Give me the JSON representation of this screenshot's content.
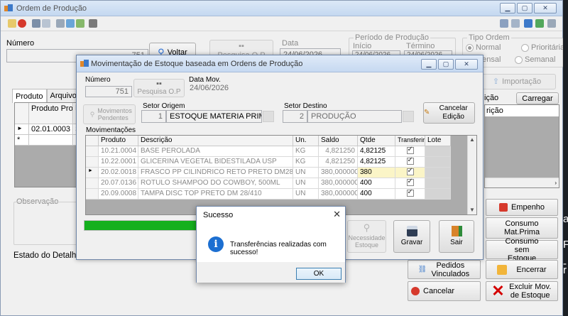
{
  "main": {
    "title": "Ordem de Produção",
    "numero_label": "Número",
    "numero_value": "751",
    "voltar_label": "Voltar",
    "pesquisa_op_label": "Pesquisa O.P",
    "data_label": "Data",
    "data_value": "24/06/2026",
    "periodo_label": "Período de Produção",
    "inicio_label": "Início",
    "termino_label": "Término",
    "inicio_value": "24/06/2026",
    "termino_value": "24/06/2026",
    "tipo_ordem_label": "Tipo Ordem",
    "radio_normal": "Normal",
    "radio_prioritaria": "Prioritária",
    "radio_mensal": "Mensal",
    "radio_semanal": "Semanal",
    "importacao_label": "Importação",
    "tabs": [
      "Produto",
      "Arquivos"
    ],
    "grid_headers": [
      "Produto Produção",
      "D"
    ],
    "grid_row": {
      "marker": "►",
      "produto": "02.01.0003",
      "d": "S"
    },
    "new_row_marker": "*",
    "descricao_header": "ição",
    "descricao_row": "rição",
    "carregar_label": "Carregar",
    "observacao_label": "Observação",
    "estado_label": "Estado do Detalhar",
    "side_buttons": {
      "empenho": "Empenho",
      "consumo_mat_prima": "Consumo Mat.Prima",
      "consumo_sem_estoque": "Consumo sem Estoque",
      "pedidos_vinculados": "Pedidos Vinculados",
      "encerrar": "Encerrar",
      "cancelar": "Cancelar",
      "excluir_mov": "Excluir Mov. de Estoque"
    },
    "edge_chars": [
      "a",
      "F",
      "-",
      "r"
    ]
  },
  "dialog": {
    "title": "Movimentação de Estoque baseada em Ordens de Produção",
    "numero_label": "Número",
    "numero_value": "751",
    "pesquisa_op_label": "Pesquisa O.P",
    "data_mov_label": "Data Mov.",
    "data_mov_value": "24/06/2026",
    "movimentos_pendentes_label": "Movimentos Pendentes",
    "setor_origem_label": "Setor Origem",
    "setor_origem_code": "1",
    "setor_origem_name": "ESTOQUE MATERIA PRIMA",
    "setor_destino_label": "Setor Destino",
    "setor_destino_code": "2",
    "setor_destino_name": "PRODUÇÃO",
    "cancelar_edicao_label": "Cancelar Edição",
    "movimentacoes_label": "Movimentações",
    "columns": [
      "Produto",
      "Descrição",
      "Un.",
      "Saldo",
      "Qtde",
      "Transferir",
      "Lote"
    ],
    "rows": [
      {
        "marker": "",
        "produto": "10.21.0004",
        "descricao": "BASE PEROLADA",
        "un": "KG",
        "saldo": "4,821250",
        "qtde": "4,82125"
      },
      {
        "marker": "",
        "produto": "10.22.0001",
        "descricao": "GLICERINA VEGETAL BIDESTILADA USP",
        "un": "KG",
        "saldo": "4,821250",
        "qtde": "4,82125"
      },
      {
        "marker": "►",
        "produto": "20.02.0018",
        "descricao": "FRASCO PP CILINDRICO RETO PRETO DM28/410 - 500ML",
        "un": "UN",
        "saldo": "380,000000",
        "qtde": "380"
      },
      {
        "marker": "",
        "produto": "20.07.0136",
        "descricao": "ROTULO SHAMPOO DO COWBOY, 500ML",
        "un": "UN",
        "saldo": "380,000000",
        "qtde": "400"
      },
      {
        "marker": "",
        "produto": "20.09.0008",
        "descricao": "TAMPA DISC TOP PRETO DM 28/410",
        "un": "UN",
        "saldo": "380,000000",
        "qtde": "400"
      }
    ],
    "progress_fraction": 1.0,
    "necessidade_label": "Necessidade Estoque",
    "gravar_label": "Gravar",
    "sair_label": "Sair"
  },
  "msgbox": {
    "title": "Sucesso",
    "text": "Transferências realizadas com sucesso!",
    "ok_label": "OK",
    "close_glyph": "✕",
    "info_glyph": "i"
  },
  "colors": {
    "progress": "#14b01e",
    "info_icon": "#1c6fd1",
    "selected_row": "#fbf5c7"
  }
}
